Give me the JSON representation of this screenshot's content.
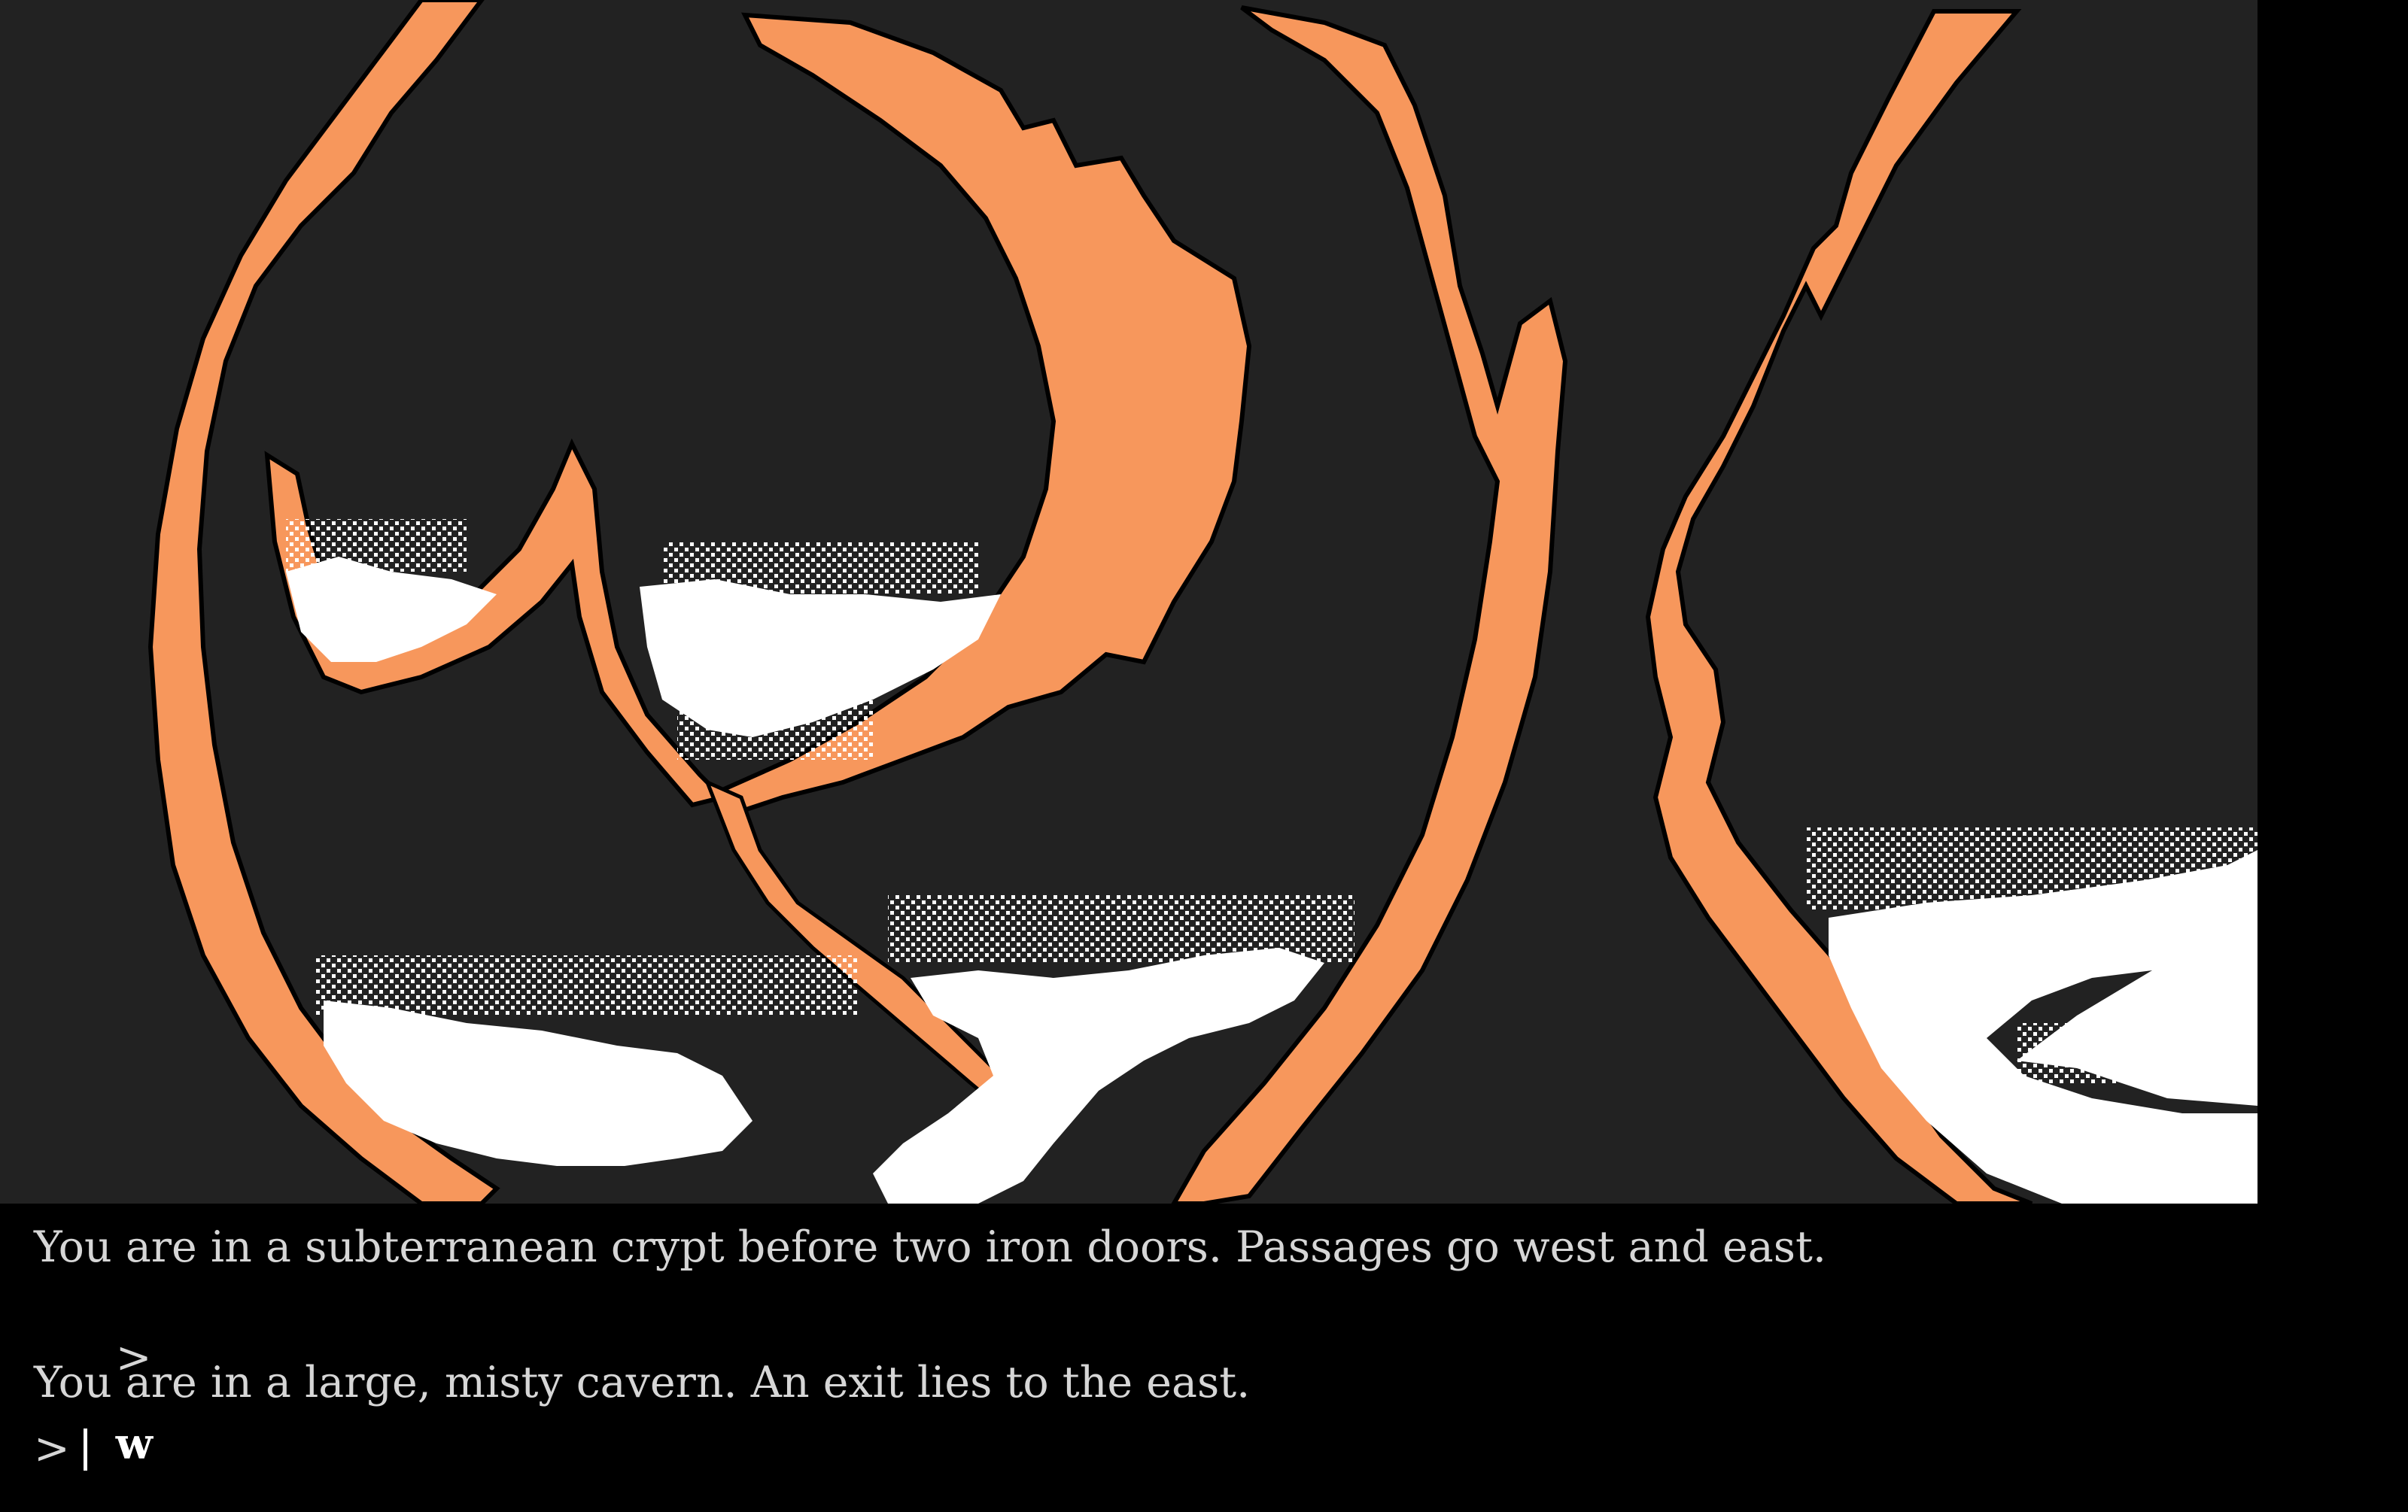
{
  "transcript": {
    "lines": [
      {
        "type": "output",
        "text": "You are in a subterranean crypt before two iron doors. Passages go west and east."
      },
      {
        "type": "command",
        "prompt": ">",
        "text": "w"
      },
      {
        "type": "output",
        "text": "You are in a large, misty cavern. An exit lies to the east."
      }
    ],
    "input": {
      "prompt": ">",
      "value": ""
    }
  },
  "scene": {
    "subject": "misty cavern",
    "colors": {
      "background": "#222222",
      "rock_edge": "#f7975c",
      "mist": "#ffffff",
      "outline": "#000000"
    }
  }
}
